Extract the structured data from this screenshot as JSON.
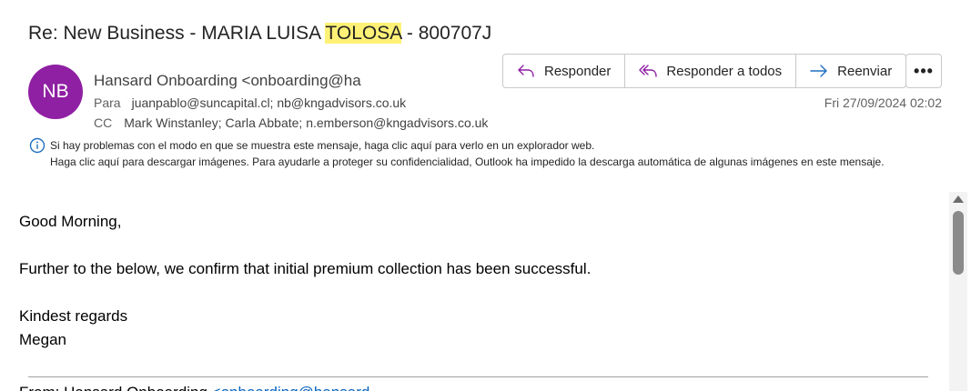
{
  "message": {
    "subject_prefix": "Re: New Business - MARIA LUISA ",
    "subject_highlight": "TOLOSA",
    "subject_suffix": " - 800707J",
    "avatar_initials": "NB",
    "avatar_color": "#8f1fa3",
    "sender": "Hansard Onboarding <onboarding@ha",
    "to_label": "Para",
    "to": "juanpablo@suncapital.cl; nb@kngadvisors.co.uk",
    "cc_label": "CC",
    "cc": "Mark Winstanley; Carla Abbate; n.emberson@kngadvisors.co.uk",
    "date": "Fri 27/09/2024 02:02"
  },
  "actions": {
    "reply": "Responder",
    "reply_all": "Responder a todos",
    "forward": "Reenviar",
    "more_icon": "more-horizontal-icon"
  },
  "info": {
    "line1": "Si hay problemas con el modo en que se muestra este mensaje, haga clic aquí para verlo en un explorador web.",
    "line2": "Haga clic aquí para descargar imágenes. Para ayudarle a proteger su confidencialidad, Outlook ha impedido la descarga automática de algunas imágenes en este mensaje."
  },
  "body": {
    "greeting": "Good Morning,",
    "line1": "Further to the below, we confirm that initial premium collection has been successful.",
    "regards": "Kindest regards",
    "signature": "Megan",
    "cutoff_prefix": "From: Hansard Onboarding ",
    "cutoff_link": "<onboarding@hansard"
  },
  "colors": {
    "highlight": "#fff176",
    "accent": "#8f1fa3",
    "link": "#0563c1"
  }
}
